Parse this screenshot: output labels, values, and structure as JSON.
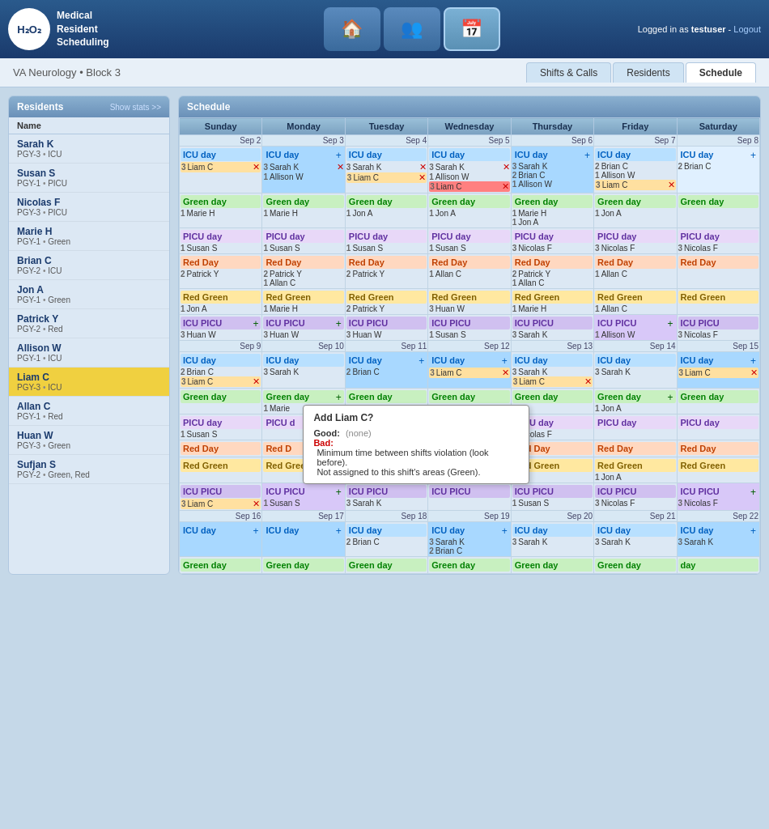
{
  "header": {
    "logo_h2": "H₂O₂",
    "logo_text": "Medical\nResident\nScheduling",
    "user_text": "Logged in as",
    "username": "testuser",
    "logout": "Logout"
  },
  "nav": {
    "home_label": "🏠",
    "people_label": "👥",
    "calendar_label": "📅"
  },
  "subheader": {
    "location": "VA Neurology",
    "separator": "•",
    "block": "Block 3",
    "tabs": [
      "Shifts & Calls",
      "Residents",
      "Schedule"
    ]
  },
  "sidebar": {
    "title": "Residents",
    "show_stats": "Show stats >>",
    "col_name": "Name",
    "residents": [
      {
        "name": "Sarah K",
        "pgy": "PGY-3",
        "area": "ICU"
      },
      {
        "name": "Susan S",
        "pgy": "PGY-1",
        "area": "PICU"
      },
      {
        "name": "Nicolas F",
        "pgy": "PGY-3",
        "area": "PICU"
      },
      {
        "name": "Marie H",
        "pgy": "PGY-1",
        "area": "Green"
      },
      {
        "name": "Brian C",
        "pgy": "PGY-2",
        "area": "ICU"
      },
      {
        "name": "Jon A",
        "pgy": "PGY-1",
        "area": "Green"
      },
      {
        "name": "Patrick Y",
        "pgy": "PGY-2",
        "area": "Red"
      },
      {
        "name": "Allison W",
        "pgy": "PGY-1",
        "area": "ICU"
      },
      {
        "name": "Liam C",
        "pgy": "PGY-3",
        "area": "ICU",
        "selected": true
      },
      {
        "name": "Allan C",
        "pgy": "PGY-1",
        "area": "Red"
      },
      {
        "name": "Huan W",
        "pgy": "PGY-3",
        "area": "Green"
      },
      {
        "name": "Sufjan S",
        "pgy": "PGY-2",
        "area": "Green, Red"
      }
    ]
  },
  "schedule": {
    "title": "Schedule",
    "days": [
      "Sunday",
      "Monday",
      "Tuesday",
      "Wednesday",
      "Thursday",
      "Friday",
      "Saturday"
    ],
    "tooltip": {
      "title": "Add Liam C?",
      "good_label": "Good:",
      "good_value": "(none)",
      "bad_label": "Bad:",
      "bad_msg1": "Minimum time between shifts violation (look before).",
      "bad_msg2": "Not assigned to this shift's areas (Green)."
    }
  }
}
